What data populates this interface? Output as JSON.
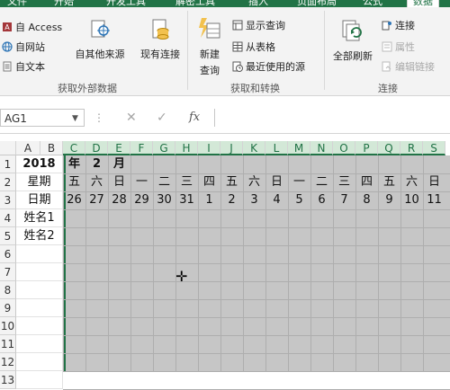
{
  "ribbon_tabs": [
    {
      "label": "文件",
      "active": false
    },
    {
      "label": "开始",
      "active": false
    },
    {
      "label": "开发工具",
      "active": false
    },
    {
      "label": "解密工具",
      "active": false
    },
    {
      "label": "插入",
      "active": false
    },
    {
      "label": "页面布局",
      "active": false
    },
    {
      "label": "公式",
      "active": false
    },
    {
      "label": "数据",
      "active": true
    }
  ],
  "ribbon": {
    "get_external": {
      "from_access": "自 Access",
      "from_web": "自网站",
      "from_text": "自文本",
      "from_other": "自其他来源",
      "existing": "现有连接",
      "group_label": "获取外部数据"
    },
    "get_transform": {
      "new_query": "新建\n查询",
      "new_query_line1": "新建",
      "new_query_line2": "查询",
      "show_queries": "显示查询",
      "from_table": "从表格",
      "recent_sources": "最近使用的源",
      "group_label": "获取和转换"
    },
    "connections": {
      "refresh_all": "全部刷新",
      "connections": "连接",
      "properties": "属性",
      "edit_links": "编辑链接",
      "group_label": "连接"
    }
  },
  "formula_bar": {
    "name_box": "AG1",
    "fx": "fx",
    "formula": ""
  },
  "grid": {
    "column_headers": [
      "A",
      "B",
      "C",
      "D",
      "E",
      "F",
      "G",
      "H",
      "I",
      "J",
      "K",
      "L",
      "M",
      "N",
      "O",
      "P",
      "Q",
      "R",
      "S"
    ],
    "row_headers": [
      "1",
      "2",
      "3",
      "4",
      "5",
      "6",
      "7",
      "8",
      "9",
      "10",
      "11",
      "12",
      "13"
    ],
    "cells": {
      "A1": "2018",
      "C1": "年",
      "D1": "2",
      "E1": "月",
      "A2": "星期",
      "A3": "日期",
      "A4": "姓名1",
      "A5": "姓名2",
      "weekday_row": [
        "五",
        "六",
        "日",
        "一",
        "二",
        "三",
        "四",
        "五",
        "六",
        "日",
        "一",
        "二",
        "三",
        "四",
        "五",
        "六",
        "日"
      ],
      "date_row": [
        "26",
        "27",
        "28",
        "29",
        "30",
        "31",
        "1",
        "2",
        "3",
        "4",
        "5",
        "6",
        "7",
        "8",
        "9",
        "10",
        "11"
      ]
    }
  }
}
